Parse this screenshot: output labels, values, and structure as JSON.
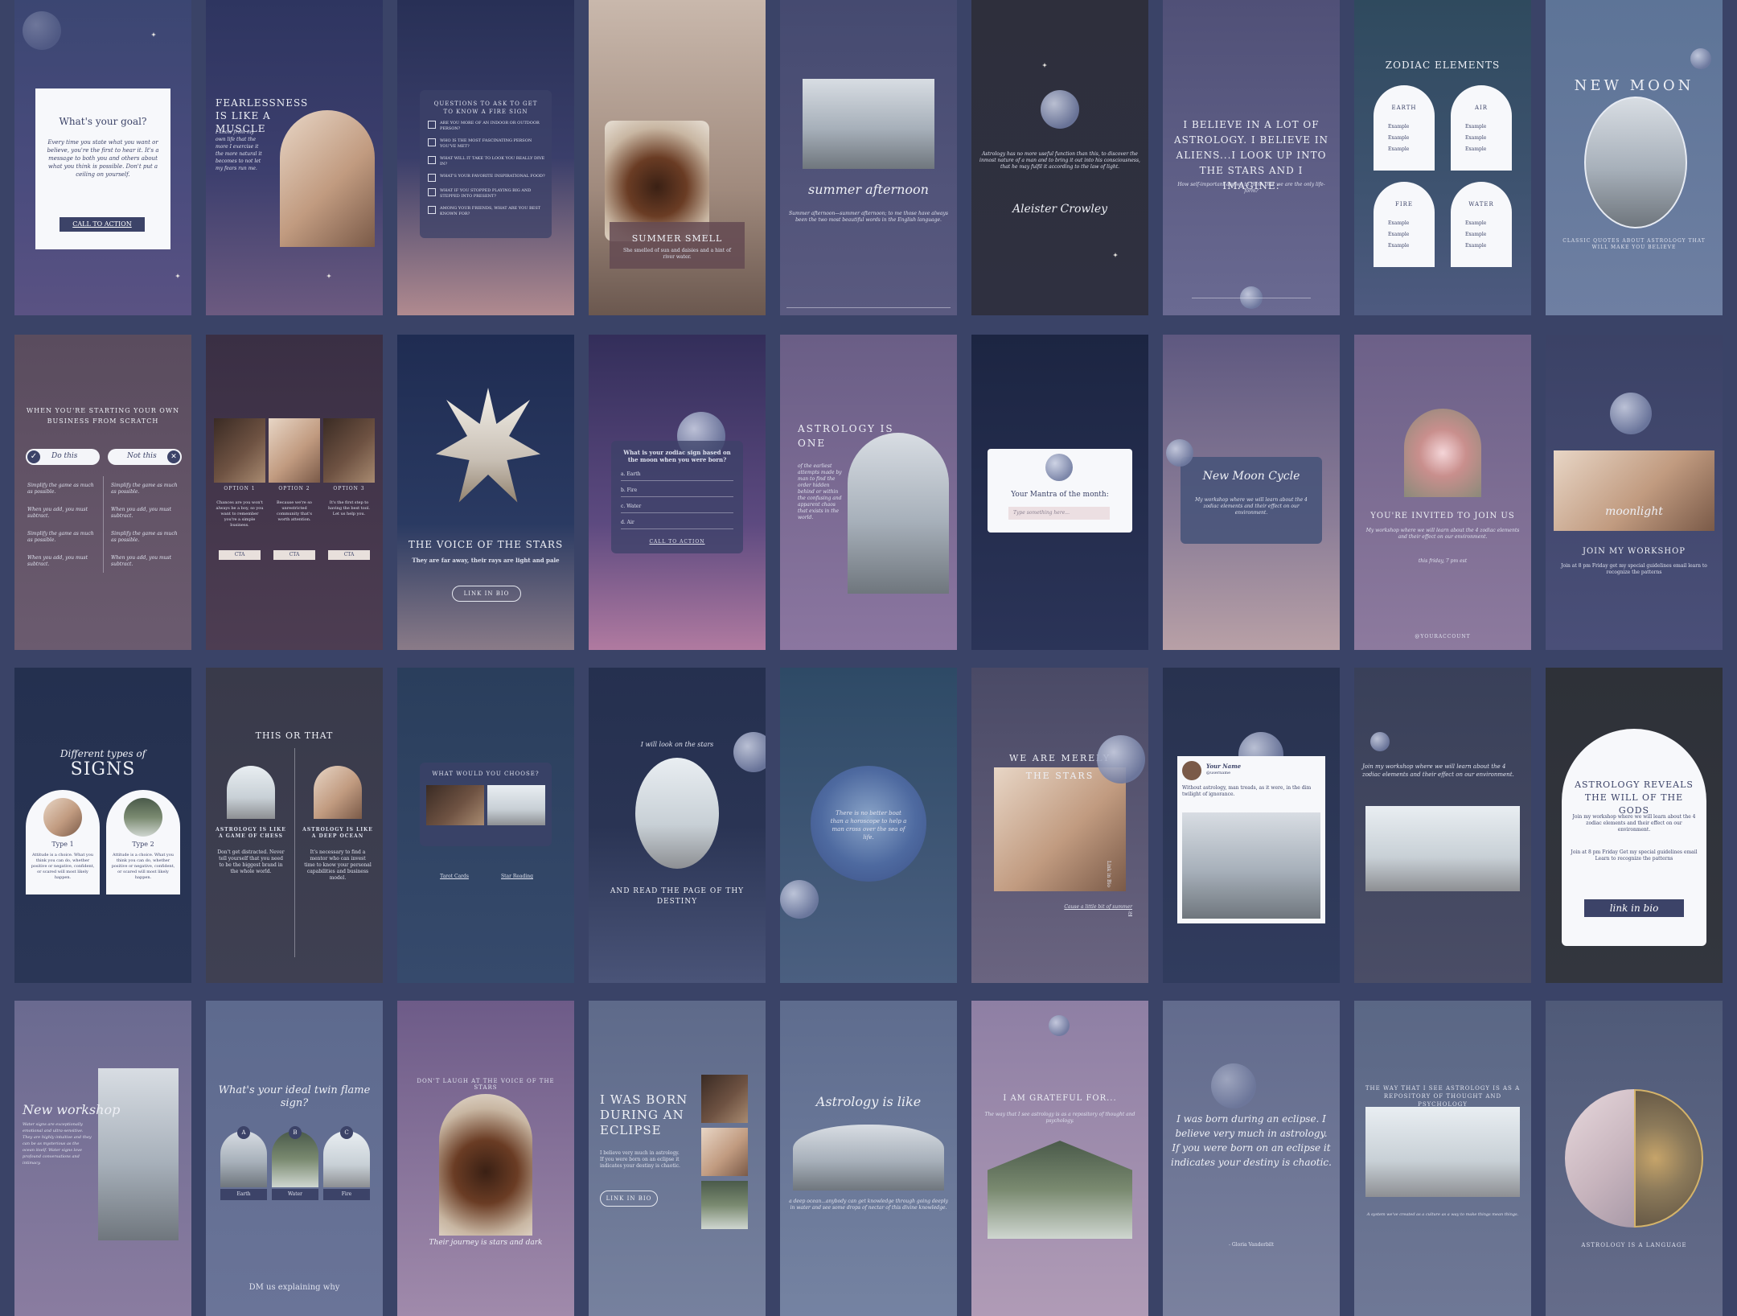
{
  "cards": {
    "c0": {
      "title": "What's your goal?",
      "body": "Every time you state what you want or believe, you're the first to hear it. It's a message to both you and others about what you think is possible. Don't put a ceiling on yourself.",
      "cta": "CALL TO ACTION"
    },
    "c1": {
      "title": "FEARLESSNESS IS LIKE A MUSCLE",
      "body": "I know from my own life that the more I exercise it the more natural it becomes to not let my fears run me."
    },
    "c2": {
      "title": "QUESTIONS TO ASK TO GET TO KNOW A FIRE SIGN",
      "items": [
        "ARE YOU MORE OF AN INDOOR OR OUTDOOR PERSON?",
        "WHO IS THE MOST FASCINATING PERSON YOU'VE MET?",
        "WHAT WILL IT TAKE TO LOOK YOU REALLY DIVE IN?",
        "WHAT'S YOUR FAVORITE INSPIRATIONAL FOOD?",
        "WHAT IF YOU STOPPED PLAYING BIG AND STEPPED INTO PRESENT?",
        "AMONG YOUR FRIENDS, WHAT ARE YOU BEST KNOWN FOR?"
      ]
    },
    "c3": {
      "title": "SUMMER SMELL",
      "body": "She smelled of sun and daisies and a hint of river water."
    },
    "c4": {
      "title": "summer afternoon",
      "body": "Summer afternoon—summer afternoon; to me those have always been the two most beautiful words in the English language."
    },
    "c5": {
      "body": "Astrology has no more useful function than this, to discover the inmost nature of a man and to bring it out into his consciousness, that he may fulfil it according to the law of light.",
      "signature": "Aleister Crowley"
    },
    "c6": {
      "title": "I BELIEVE IN A LOT OF ASTROLOGY. I BELIEVE IN ALIENS...I LOOK UP INTO THE STARS AND I IMAGINE:",
      "body": "How self-important are we to think that we are the only life-form?"
    },
    "c7": {
      "title": "ZODIAC ELEMENTS",
      "elements": [
        "EARTH",
        "AIR",
        "FIRE",
        "WATER"
      ],
      "example": "Example"
    },
    "c8": {
      "title": "NEW MOON",
      "body": "CLASSIC QUOTES ABOUT ASTROLOGY THAT WILL MAKE YOU BELIEVE"
    },
    "c9": {
      "title": "WHEN YOU'RE STARTING YOUR OWN BUSINESS FROM SCRATCH",
      "left": "Do this",
      "right": "Not this",
      "items": [
        "Simplify the game as much as possible.",
        "When you add, you must subtract.",
        "Simplify the game as much as possible.",
        "When you add, you must subtract."
      ]
    },
    "c10": {
      "options": [
        "OPTION 1",
        "OPTION 2",
        "OPTION 3"
      ],
      "cta": "CTA",
      "bodies": [
        "Chances are you won't always be a boy, so you want to remember you're a simple business.",
        "Because we're so unrestricted community that's worth attention.",
        "It's the first step to having the best tool. Let us help you."
      ]
    },
    "c11": {
      "title": "THE VOICE OF THE STARS",
      "body": "They are far away, their rays are light and pale",
      "cta": "LINK IN BIO"
    },
    "c12": {
      "title": "What is your zodiac sign based on the moon when you were born?",
      "options": [
        "a. Earth",
        "b. Fire",
        "c. Water",
        "d. Air"
      ],
      "cta": "CALL TO ACTION"
    },
    "c13": {
      "title": "ASTROLOGY IS ONE",
      "body": "of the earliest attempts made by man to find the order hidden behind or within the confusing and apparent chaos that exists in the world."
    },
    "c14": {
      "title": "Your Mantra of the month:",
      "placeholder": "Type something here..."
    },
    "c15": {
      "title": "New Moon Cycle",
      "body": "My workshop where we will learn about the 4 zodiac elements and their effect on our environment."
    },
    "c16": {
      "title": "YOU'RE INVITED TO JOIN US",
      "body": "My workshop where we will learn about the 4 zodiac elements and their effect on our environment.",
      "date": "this friday, 7 pm est",
      "handle": "@YOURACCOUNT"
    },
    "c17": {
      "title": "JOIN MY WORKSHOP",
      "script": "moonlight",
      "body": "Join at 8 pm Friday get my special guidelines email learn to recognize the patterns"
    },
    "c18": {
      "pre": "Different types of",
      "title": "SIGNS",
      "types": [
        "Type 1",
        "Type 2"
      ],
      "body": "Attitude is a choice. What you think you can do, whether positive or negative, confident, or scared will most likely happen."
    },
    "c19": {
      "title": "THIS OR THAT",
      "left": "ASTROLOGY IS LIKE A GAME OF CHESS",
      "right": "ASTROLOGY IS LIKE A DEEP OCEAN",
      "leftBody": "Don't get distracted. Never tell yourself that you need to be the biggest brand in the whole world.",
      "rightBody": "It's necessary to find a mentor who can invest time to know your personal capabilities and business model."
    },
    "c20": {
      "title": "WHAT WOULD YOU CHOOSE?",
      "left": "Tarot Cards",
      "right": "Star Reading"
    },
    "c21": {
      "top": "I will look on the stars",
      "body": "AND READ THE PAGE OF THY DESTINY"
    },
    "c22": {
      "body": "There is no better boat than a horoscope to help a man cross over the sea of life."
    },
    "c23": {
      "title": "WE ARE MERELY",
      "sub": "THE STARS",
      "link": "Cause a little bit of summer is",
      "side": "Link in Bio"
    },
    "c24": {
      "name": "Your Name",
      "handle": "@username",
      "body": "Without astrology, man treads, as it were, in the dim twilight of ignorance."
    },
    "c25": {
      "body": "Join my workshop where we will learn about the 4 zodiac elements and their effect on our environment."
    },
    "c26": {
      "title": "ASTROLOGY REVEALS THE WILL OF THE GODS",
      "body": "Join my workshop where we will learn about the 4 zodiac elements and their effect on our environment.",
      "details": "Join at 8 pm Friday Get my special guidelines email Learn to recognize the patterns",
      "cta": "link in bio"
    },
    "c27": {
      "title": "New workshop",
      "body": "Water signs are exceptionally emotional and ultra-sensitive. They are highly intuitive and they can be as mysterious as the ocean itself. Water signs love profound conversations and intimacy."
    },
    "c28": {
      "title": "What's your ideal twin flame sign?",
      "letters": [
        "A",
        "B",
        "C"
      ],
      "labels": [
        "Earth",
        "Water",
        "Fire"
      ],
      "footer": "DM us explaining why"
    },
    "c29": {
      "top": "DON'T LAUGH AT THE VOICE OF THE STARS",
      "bottom": "Their journey is stars and dark"
    },
    "c30": {
      "title": "I WAS BORN DURING AN ECLIPSE",
      "body": "I believe very much in astrology. If you were born on an eclipse it indicates your destiny is chaotic.",
      "cta": "LINK IN BIO"
    },
    "c31": {
      "title": "Astrology is like",
      "body": "a deep ocean...anybody can get knowledge through going deeply in water and see some drops of nectar of this divine knowledge."
    },
    "c32": {
      "title": "I AM GRATEFUL FOR...",
      "body": "The way that I see astrology is as a repository of thought and psychology."
    },
    "c33": {
      "body": "I was born during an eclipse. I believe very much in astrology. If you were born on an eclipse it indicates your destiny is chaotic.",
      "author": "- Gloria Vanderbilt"
    },
    "c34": {
      "title": "THE WAY THAT I SEE ASTROLOGY IS AS A REPOSITORY OF THOUGHT AND PSYCHOLOGY",
      "body": "A system we've created as a culture as a way to make things mean things."
    },
    "c35": {
      "bottom": "ASTROLOGY IS A LANGUAGE"
    }
  }
}
